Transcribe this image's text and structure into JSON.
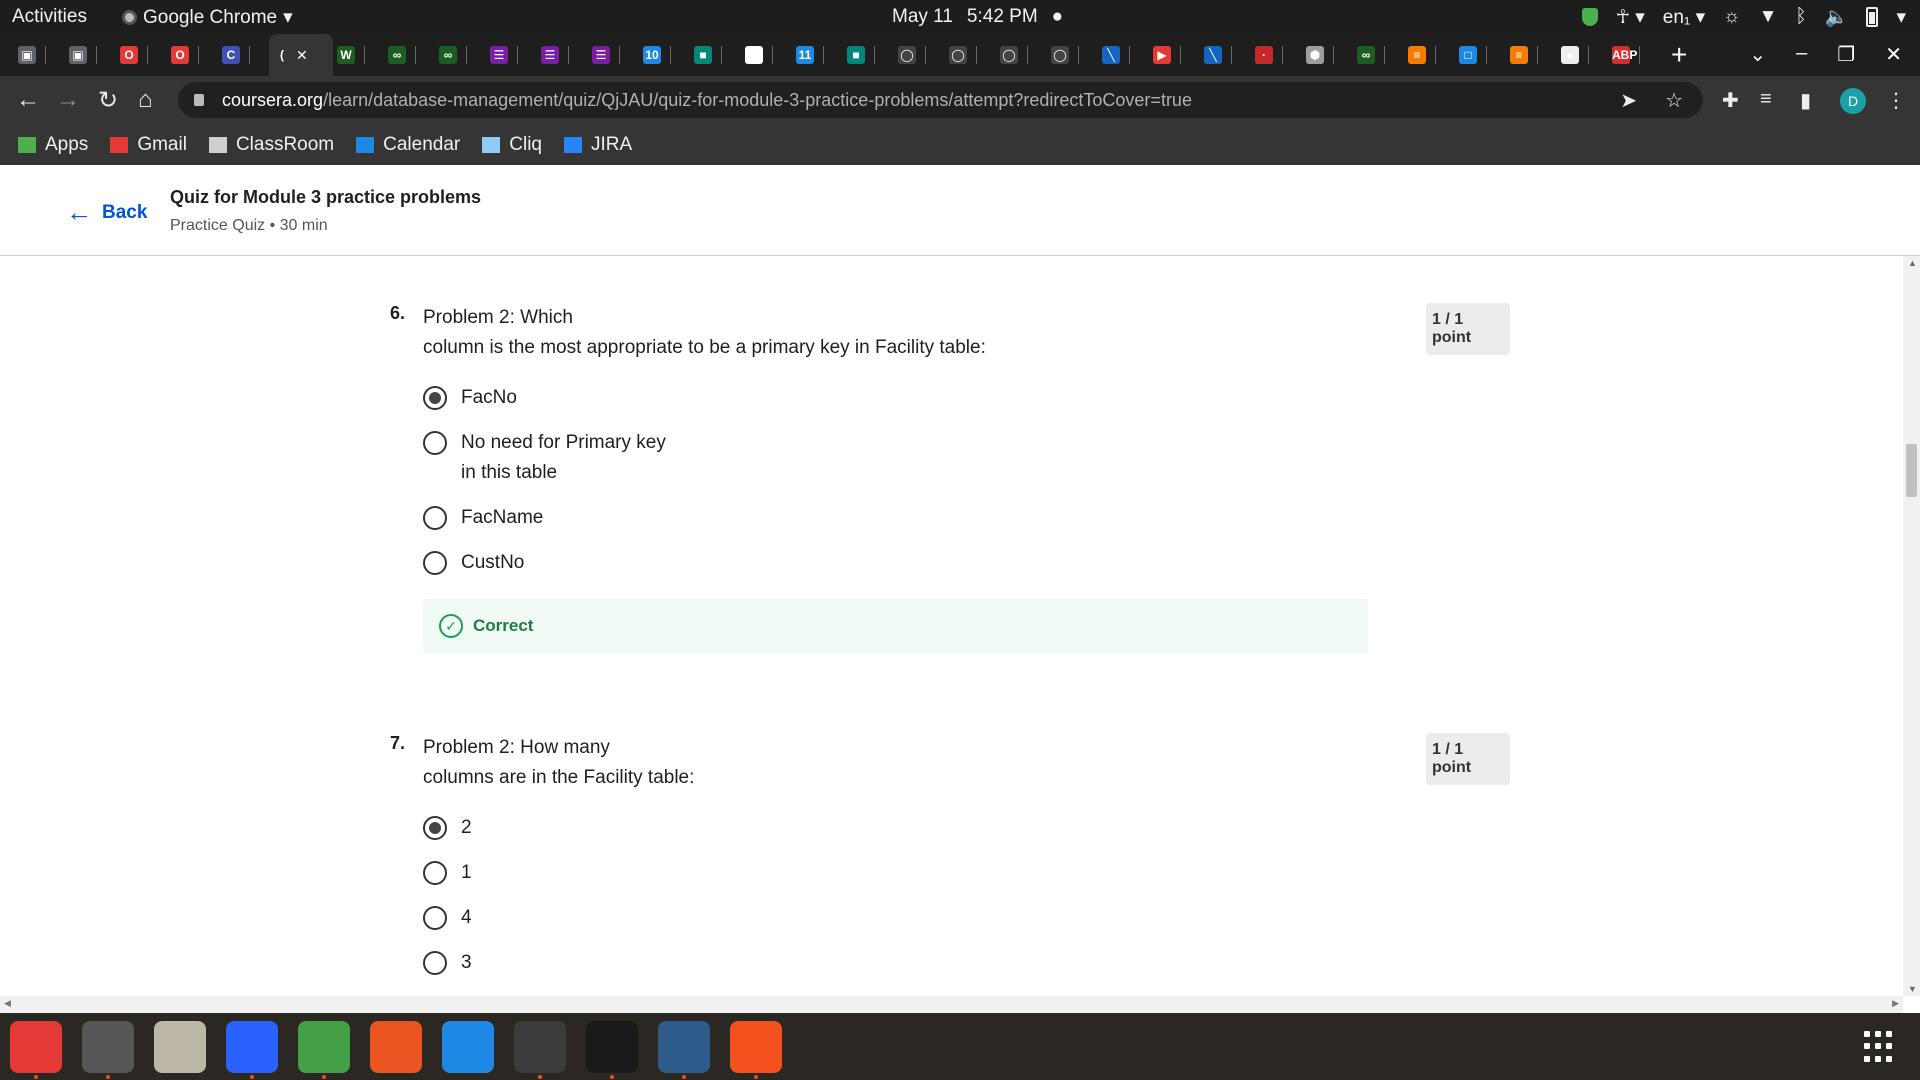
{
  "os_topbar": {
    "activities": "Activities",
    "app_name": "Google Chrome",
    "date": "May 11",
    "time": "5:42 PM",
    "lang": "en₁"
  },
  "tabs": [
    {
      "glyph": "▣",
      "color": "#5f6368"
    },
    {
      "glyph": "▣",
      "color": "#5f6368"
    },
    {
      "glyph": "O",
      "color": "#e53935"
    },
    {
      "glyph": "O",
      "color": "#e53935"
    },
    {
      "glyph": "C",
      "color": "#3f51b5"
    },
    {
      "glyph": "(",
      "color": "#353535",
      "active": true
    },
    {
      "glyph": "W",
      "color": "#1b5e20"
    },
    {
      "glyph": "∞",
      "color": "#1b5e20"
    },
    {
      "glyph": "∞",
      "color": "#1b5e20"
    },
    {
      "glyph": "☰",
      "color": "#7b1fa2"
    },
    {
      "glyph": "☰",
      "color": "#7b1fa2"
    },
    {
      "glyph": "☰",
      "color": "#7b1fa2"
    },
    {
      "glyph": "10",
      "color": "#1e88e5"
    },
    {
      "glyph": "■",
      "color": "#00897b"
    },
    {
      "glyph": "G",
      "color": "#ffffff"
    },
    {
      "glyph": "11",
      "color": "#1e88e5"
    },
    {
      "glyph": "■",
      "color": "#00897b"
    },
    {
      "glyph": "◯",
      "color": "#444444"
    },
    {
      "glyph": "◯",
      "color": "#444444"
    },
    {
      "glyph": "◯",
      "color": "#444444"
    },
    {
      "glyph": "◯",
      "color": "#444444"
    },
    {
      "glyph": "╲",
      "color": "#1565c0"
    },
    {
      "glyph": "▶",
      "color": "#e53935"
    },
    {
      "glyph": "╲",
      "color": "#1565c0"
    },
    {
      "glyph": "·",
      "color": "#c62828"
    },
    {
      "glyph": "⬢",
      "color": "#9e9e9e"
    },
    {
      "glyph": "∞",
      "color": "#1b5e20"
    },
    {
      "glyph": "≡",
      "color": "#f57c00"
    },
    {
      "glyph": "□",
      "color": "#1e88e5"
    },
    {
      "glyph": "≡",
      "color": "#f57c00"
    },
    {
      "glyph": "●",
      "color": "#eeeeee"
    },
    {
      "glyph": "ABP",
      "color": "#d32f2f"
    }
  ],
  "address_bar": {
    "domain": "coursera.org",
    "path": "/learn/database-management/quiz/QjJAU/quiz-for-module-3-practice-problems/attempt?redirectToCover=true",
    "avatar_letter": "D"
  },
  "bookmarks": [
    {
      "label": "Apps",
      "icon": "apps-grid-icon",
      "color": "#4caf50"
    },
    {
      "label": "Gmail",
      "icon": "gmail-icon",
      "color": "#e53935"
    },
    {
      "label": "ClassRoom",
      "icon": "classroom-icon",
      "color": "#cfcfcf"
    },
    {
      "label": "Calendar",
      "icon": "calendar-icon",
      "color": "#1e88e5"
    },
    {
      "label": "Cliq",
      "icon": "cliq-icon",
      "color": "#90caf9"
    },
    {
      "label": "JIRA",
      "icon": "jira-icon",
      "color": "#2684ff"
    }
  ],
  "header": {
    "back_label": "Back",
    "title": "Quiz for Module 3 practice problems",
    "subtitle": "Practice Quiz • 30 min"
  },
  "questions": [
    {
      "number": "6.",
      "text": "Problem 2: Which\ncolumn is the most appropriate to be a primary key in Facility table:",
      "points": "1 / 1 point",
      "options": [
        {
          "label": "FacNo",
          "checked": true
        },
        {
          "label": "No need for Primary key in this table",
          "checked": false
        },
        {
          "label": "FacName",
          "checked": false
        },
        {
          "label": "CustNo",
          "checked": false
        }
      ],
      "feedback": "Correct"
    },
    {
      "number": "7.",
      "text": "Problem 2: How many\ncolumns are in the Facility table:",
      "points": "1 / 1 point",
      "options": [
        {
          "label": "2",
          "checked": true
        },
        {
          "label": "1",
          "checked": false
        },
        {
          "label": "4",
          "checked": false
        },
        {
          "label": "3",
          "checked": false
        }
      ]
    }
  ],
  "dock": [
    {
      "name": "chrome",
      "color": "#e53935",
      "running": true
    },
    {
      "name": "settings",
      "color": "#555555",
      "running": true
    },
    {
      "name": "files",
      "color": "#bdb7a8",
      "running": false
    },
    {
      "name": "text-editor",
      "color": "#2962ff",
      "running": true
    },
    {
      "name": "whatsapp",
      "color": "#43a047",
      "running": true
    },
    {
      "name": "app-center",
      "color": "#e95420",
      "running": false
    },
    {
      "name": "help",
      "color": "#1e88e5",
      "running": false
    },
    {
      "name": "terminal",
      "color": "#3c3c3c",
      "running": true
    },
    {
      "name": "intellij",
      "color": "#1a1a1a",
      "running": true
    },
    {
      "name": "mysql-workbench",
      "color": "#2e5c8a",
      "running": true
    },
    {
      "name": "presentation",
      "color": "#f4511e",
      "running": true
    }
  ]
}
